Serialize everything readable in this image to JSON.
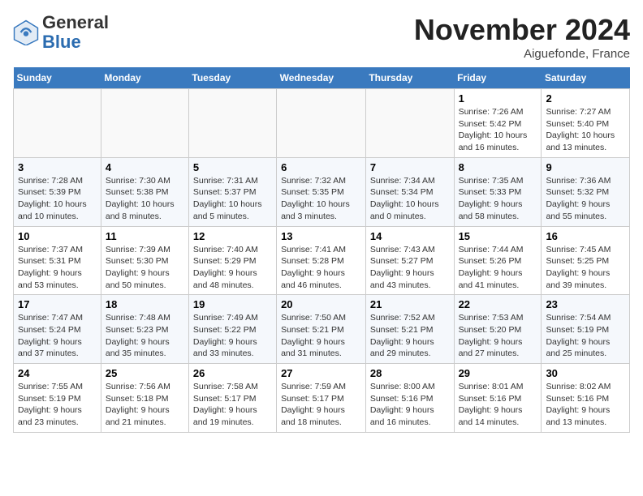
{
  "header": {
    "logo_line1": "General",
    "logo_line2": "Blue",
    "month": "November 2024",
    "location": "Aiguefonde, France"
  },
  "columns": [
    "Sunday",
    "Monday",
    "Tuesday",
    "Wednesday",
    "Thursday",
    "Friday",
    "Saturday"
  ],
  "weeks": [
    {
      "shade": false,
      "days": [
        {
          "num": "",
          "info": ""
        },
        {
          "num": "",
          "info": ""
        },
        {
          "num": "",
          "info": ""
        },
        {
          "num": "",
          "info": ""
        },
        {
          "num": "",
          "info": ""
        },
        {
          "num": "1",
          "info": "Sunrise: 7:26 AM\nSunset: 5:42 PM\nDaylight: 10 hours and 16 minutes."
        },
        {
          "num": "2",
          "info": "Sunrise: 7:27 AM\nSunset: 5:40 PM\nDaylight: 10 hours and 13 minutes."
        }
      ]
    },
    {
      "shade": true,
      "days": [
        {
          "num": "3",
          "info": "Sunrise: 7:28 AM\nSunset: 5:39 PM\nDaylight: 10 hours and 10 minutes."
        },
        {
          "num": "4",
          "info": "Sunrise: 7:30 AM\nSunset: 5:38 PM\nDaylight: 10 hours and 8 minutes."
        },
        {
          "num": "5",
          "info": "Sunrise: 7:31 AM\nSunset: 5:37 PM\nDaylight: 10 hours and 5 minutes."
        },
        {
          "num": "6",
          "info": "Sunrise: 7:32 AM\nSunset: 5:35 PM\nDaylight: 10 hours and 3 minutes."
        },
        {
          "num": "7",
          "info": "Sunrise: 7:34 AM\nSunset: 5:34 PM\nDaylight: 10 hours and 0 minutes."
        },
        {
          "num": "8",
          "info": "Sunrise: 7:35 AM\nSunset: 5:33 PM\nDaylight: 9 hours and 58 minutes."
        },
        {
          "num": "9",
          "info": "Sunrise: 7:36 AM\nSunset: 5:32 PM\nDaylight: 9 hours and 55 minutes."
        }
      ]
    },
    {
      "shade": false,
      "days": [
        {
          "num": "10",
          "info": "Sunrise: 7:37 AM\nSunset: 5:31 PM\nDaylight: 9 hours and 53 minutes."
        },
        {
          "num": "11",
          "info": "Sunrise: 7:39 AM\nSunset: 5:30 PM\nDaylight: 9 hours and 50 minutes."
        },
        {
          "num": "12",
          "info": "Sunrise: 7:40 AM\nSunset: 5:29 PM\nDaylight: 9 hours and 48 minutes."
        },
        {
          "num": "13",
          "info": "Sunrise: 7:41 AM\nSunset: 5:28 PM\nDaylight: 9 hours and 46 minutes."
        },
        {
          "num": "14",
          "info": "Sunrise: 7:43 AM\nSunset: 5:27 PM\nDaylight: 9 hours and 43 minutes."
        },
        {
          "num": "15",
          "info": "Sunrise: 7:44 AM\nSunset: 5:26 PM\nDaylight: 9 hours and 41 minutes."
        },
        {
          "num": "16",
          "info": "Sunrise: 7:45 AM\nSunset: 5:25 PM\nDaylight: 9 hours and 39 minutes."
        }
      ]
    },
    {
      "shade": true,
      "days": [
        {
          "num": "17",
          "info": "Sunrise: 7:47 AM\nSunset: 5:24 PM\nDaylight: 9 hours and 37 minutes."
        },
        {
          "num": "18",
          "info": "Sunrise: 7:48 AM\nSunset: 5:23 PM\nDaylight: 9 hours and 35 minutes."
        },
        {
          "num": "19",
          "info": "Sunrise: 7:49 AM\nSunset: 5:22 PM\nDaylight: 9 hours and 33 minutes."
        },
        {
          "num": "20",
          "info": "Sunrise: 7:50 AM\nSunset: 5:21 PM\nDaylight: 9 hours and 31 minutes."
        },
        {
          "num": "21",
          "info": "Sunrise: 7:52 AM\nSunset: 5:21 PM\nDaylight: 9 hours and 29 minutes."
        },
        {
          "num": "22",
          "info": "Sunrise: 7:53 AM\nSunset: 5:20 PM\nDaylight: 9 hours and 27 minutes."
        },
        {
          "num": "23",
          "info": "Sunrise: 7:54 AM\nSunset: 5:19 PM\nDaylight: 9 hours and 25 minutes."
        }
      ]
    },
    {
      "shade": false,
      "days": [
        {
          "num": "24",
          "info": "Sunrise: 7:55 AM\nSunset: 5:19 PM\nDaylight: 9 hours and 23 minutes."
        },
        {
          "num": "25",
          "info": "Sunrise: 7:56 AM\nSunset: 5:18 PM\nDaylight: 9 hours and 21 minutes."
        },
        {
          "num": "26",
          "info": "Sunrise: 7:58 AM\nSunset: 5:17 PM\nDaylight: 9 hours and 19 minutes."
        },
        {
          "num": "27",
          "info": "Sunrise: 7:59 AM\nSunset: 5:17 PM\nDaylight: 9 hours and 18 minutes."
        },
        {
          "num": "28",
          "info": "Sunrise: 8:00 AM\nSunset: 5:16 PM\nDaylight: 9 hours and 16 minutes."
        },
        {
          "num": "29",
          "info": "Sunrise: 8:01 AM\nSunset: 5:16 PM\nDaylight: 9 hours and 14 minutes."
        },
        {
          "num": "30",
          "info": "Sunrise: 8:02 AM\nSunset: 5:16 PM\nDaylight: 9 hours and 13 minutes."
        }
      ]
    }
  ]
}
